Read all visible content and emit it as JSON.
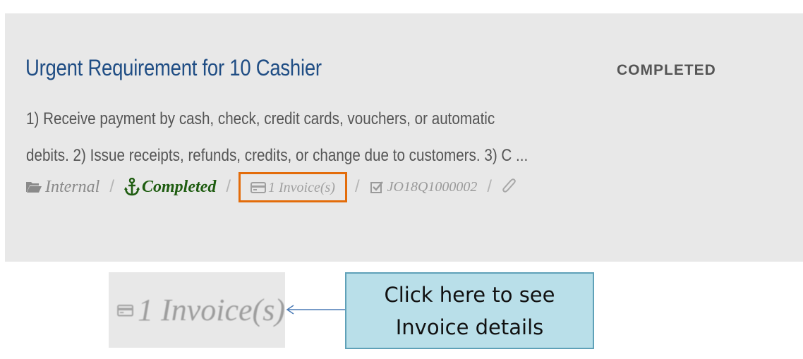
{
  "job": {
    "title": "Urgent Requirement for 10 Cashier",
    "status": "COMPLETED",
    "description_line1": "1) Receive payment by cash, check, credit cards, vouchers, or automatic",
    "description_line2": "debits. 2) Issue receipts, refunds, credits, or change due to customers. 3) C ...",
    "meta": {
      "category": "Internal",
      "state": "Completed",
      "invoices": "1 Invoice(s)",
      "job_order_id": "JO18Q1000002",
      "category_icon": "folder-open-icon",
      "state_icon": "anchor-icon",
      "invoice_icon": "credit-card-icon",
      "job_order_icon": "checked-box-icon",
      "attachment_icon": "paperclip-icon"
    }
  },
  "annotation": {
    "zoom_label": "1 Invoice(s)",
    "callout_line1": "Click here to see",
    "callout_line2": "Invoice details"
  },
  "colors": {
    "title": "#1f4d84",
    "completed": "#1f5d11",
    "highlight_border": "#e36c0a",
    "callout_bg": "#b9dfe9",
    "callout_border": "#5fa1b8"
  }
}
